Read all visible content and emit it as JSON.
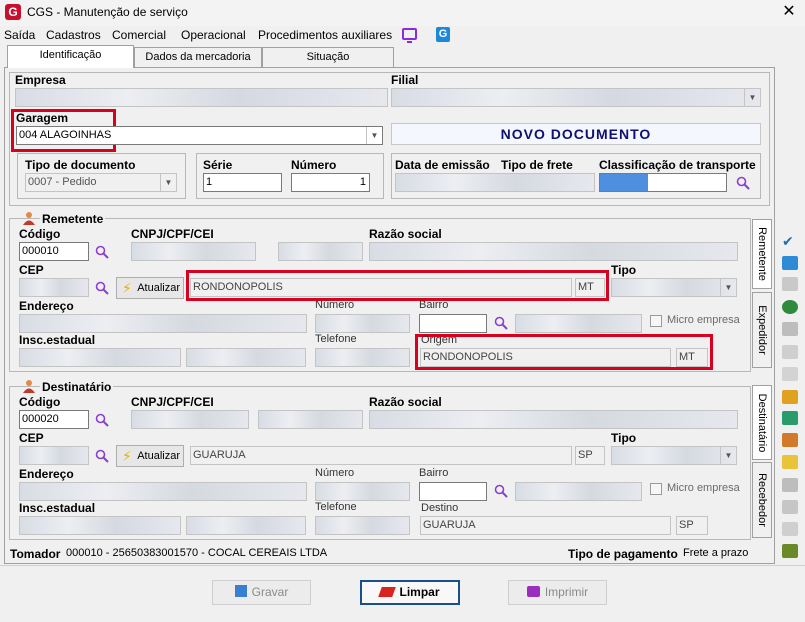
{
  "window": {
    "title": "CGS - Manutenção de serviço",
    "close": "✕"
  },
  "menu": [
    "Saída",
    "Cadastros",
    "Comercial",
    "Operacional",
    "Procedimentos auxiliares"
  ],
  "tabs": [
    "Identificação",
    "Dados da mercadoria",
    "Situação"
  ],
  "empresa": {
    "label": "Empresa",
    "value": ""
  },
  "filial": {
    "label": "Filial",
    "value": ""
  },
  "garagem": {
    "label": "Garagem",
    "value": "004 ALAGOINHAS"
  },
  "novo_documento": "NOVO DOCUMENTO",
  "tipo_documento": {
    "label": "Tipo de documento",
    "value": "0007 - Pedido"
  },
  "serie": {
    "label": "Série",
    "value": "1"
  },
  "numero": {
    "label": "Número",
    "value": "1"
  },
  "datas": {
    "emissao": "Data de emissão",
    "frete": "Tipo de frete",
    "classificacao": "Classificação de transporte"
  },
  "remetente": {
    "title": "Remetente",
    "codigo_label": "Código",
    "codigo": "000010",
    "cnpj_label": "CNPJ/CPF/CEI",
    "razao_label": "Razão social",
    "cep_label": "CEP",
    "atualizar": "Atualizar",
    "cidade": "RONDONOPOLIS",
    "uf": "MT",
    "tipo_label": "Tipo",
    "endereco_label": "Endereço",
    "numero_label": "Número",
    "bairro_label": "Bairro",
    "micro_empresa": "Micro empresa",
    "insc_label": "Insc.estadual",
    "telefone_label": "Telefone",
    "origem_label": "Origem",
    "origem": "RONDONOPOLIS",
    "origem_uf": "MT"
  },
  "destinatario": {
    "title": "Destinatário",
    "codigo_label": "Código",
    "codigo": "000020",
    "cnpj_label": "CNPJ/CPF/CEI",
    "razao_label": "Razão social",
    "cep_label": "CEP",
    "atualizar": "Atualizar",
    "cidade": "GUARUJA",
    "uf": "SP",
    "tipo_label": "Tipo",
    "endereco_label": "Endereço",
    "numero_label": "Número",
    "bairro_label": "Bairro",
    "micro_empresa": "Micro empresa",
    "insc_label": "Insc.estadual",
    "telefone_label": "Telefone",
    "destino_label": "Destino",
    "destino": "GUARUJA",
    "destino_uf": "SP"
  },
  "side_tabs": [
    "Remetente",
    "Expedidor",
    "Destinatário",
    "Recebedor"
  ],
  "tomador": {
    "label": "Tomador",
    "value": "000010 - 25650383001570 - COCAL CEREAIS LTDA"
  },
  "pagamento": {
    "label": "Tipo de pagamento",
    "value": "Frete a prazo"
  },
  "buttons": {
    "gravar": "Gravar",
    "limpar": "Limpar",
    "imprimir": "Imprimir"
  },
  "colors": {
    "red_highlight": "#d8001f",
    "brand": "#c8102e",
    "novo_text": "#101070"
  }
}
